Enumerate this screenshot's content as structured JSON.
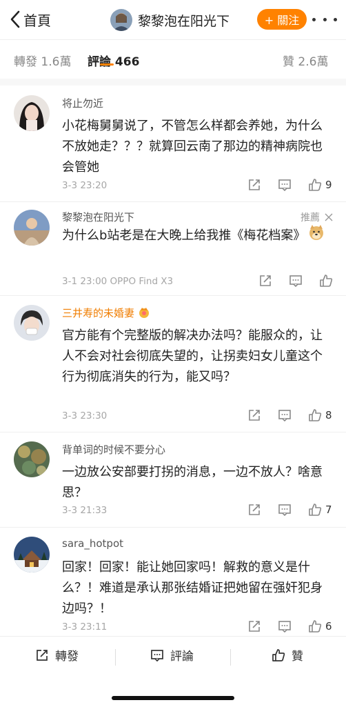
{
  "header": {
    "back_label": "首頁",
    "title": "黎黎泡在阳光下",
    "follow_label": "+ 關注"
  },
  "tabs": [
    {
      "label": "轉發 1.6萬"
    },
    {
      "label": "評論 466"
    },
    {
      "label": "贊 2.6萬"
    }
  ],
  "comments": [
    {
      "name": "将止勿近",
      "text": "小花梅舅舅说了，不管怎么样都会养她，为什么不放她走？？？就算回云南了那边的精神病院也会管她",
      "meta": "3-3 23:20",
      "likes": "9"
    },
    {
      "name": "黎黎泡在阳光下",
      "text": "为什么b站老是在大晚上给我推《梅花档案》",
      "emoji": "doge",
      "meta": "3-1 23:00  OPPO Find X3",
      "recommend": "推薦"
    },
    {
      "name": "三井寿的未婚妻",
      "text": "官方能有个完整版的解决办法吗？能服众的，让人不会对社会彻底失望的，让拐卖妇女儿童这个行为彻底消失的行为，能又吗？",
      "meta": "3-3 23:30",
      "likes": "8"
    },
    {
      "name": "背单词的时候不要分心",
      "text": "一边放公安部要打拐的消息，一边不放人？啥意思？",
      "meta": "3-3 21:33",
      "likes": "7"
    },
    {
      "name": "sara_hotpot",
      "text": "回家！回家！能让她回家吗！解救的意义是什么？！难道是承认那张结婚证把她留在强奸犯身边吗？！",
      "meta": "3-3 23:11",
      "likes": "6"
    }
  ],
  "bottom": {
    "repost": "轉發",
    "comment": "評論",
    "like": "贊"
  },
  "colors": {
    "accent": "#ff8200",
    "vip_name": "#f07d00"
  }
}
